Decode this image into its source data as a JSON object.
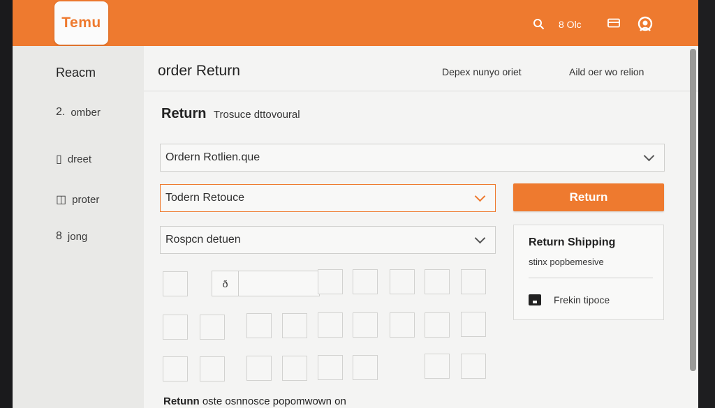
{
  "header": {
    "logo_text": "Temu",
    "search_icon": "search-icon",
    "status_text": "8 Olc",
    "card_icon": "card-icon",
    "account_icon": "account-icon"
  },
  "sidebar": {
    "title": "Reacm",
    "items": [
      {
        "icon": "2.",
        "label": "omber"
      },
      {
        "icon": "▯",
        "label": "dreet"
      },
      {
        "icon": "◫",
        "label": "proter"
      },
      {
        "icon": "8",
        "label": "jong"
      }
    ]
  },
  "main": {
    "title": "order Return",
    "head_link_1": "Depex nunyo oriet",
    "head_link_2": "Aild oer wo relion",
    "section_title": "Return",
    "section_subtitle": "Trosuce dttovoural",
    "select_order": "Ordern Rotlien.que",
    "select_reason": "Todern Retouce",
    "select_option": "Rospcn detuen",
    "return_button": "Return",
    "grid_cell_label": "ð",
    "footer_bold": "Retunn",
    "footer_text": "oste osnnosce popomwown on"
  },
  "shipping": {
    "title": "Return Shipping",
    "subtitle": "stinx popbemesive",
    "row_label": "Frekin tipoce"
  },
  "colors": {
    "accent": "#ee7a2f",
    "background": "#f1f1f0"
  }
}
